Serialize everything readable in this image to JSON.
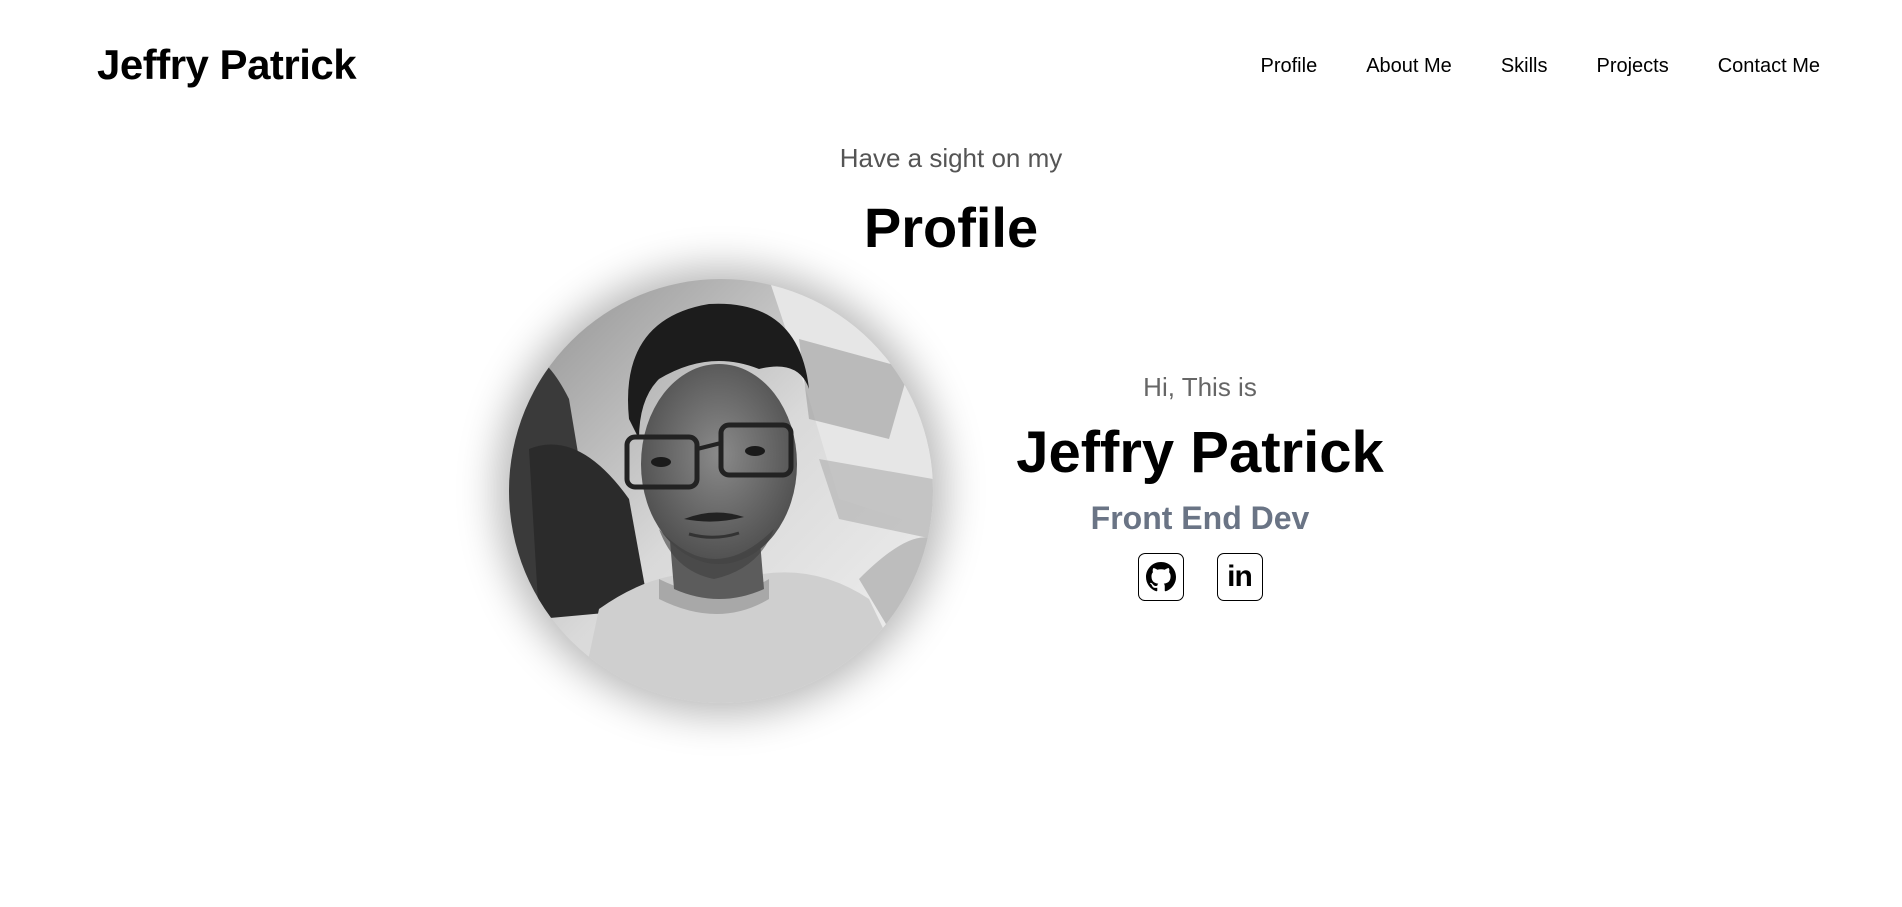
{
  "header": {
    "logo": "Jeffry Patrick",
    "nav": [
      {
        "label": "Profile"
      },
      {
        "label": "About Me"
      },
      {
        "label": "Skills"
      },
      {
        "label": "Projects"
      },
      {
        "label": "Contact Me"
      }
    ]
  },
  "section": {
    "subtitle": "Have a sight on my",
    "title": "Profile"
  },
  "profile": {
    "photo_icon": "profile-photo",
    "greeting": "Hi, This is",
    "name": "Jeffry Patrick",
    "role": "Front End Dev",
    "socials": [
      {
        "icon": "github-icon"
      },
      {
        "icon": "linkedin-icon",
        "label": "in"
      }
    ]
  },
  "colors": {
    "background": "#ffffff",
    "text": "#000000",
    "subtle_text": "#666666",
    "role_text": "#6a7485"
  }
}
